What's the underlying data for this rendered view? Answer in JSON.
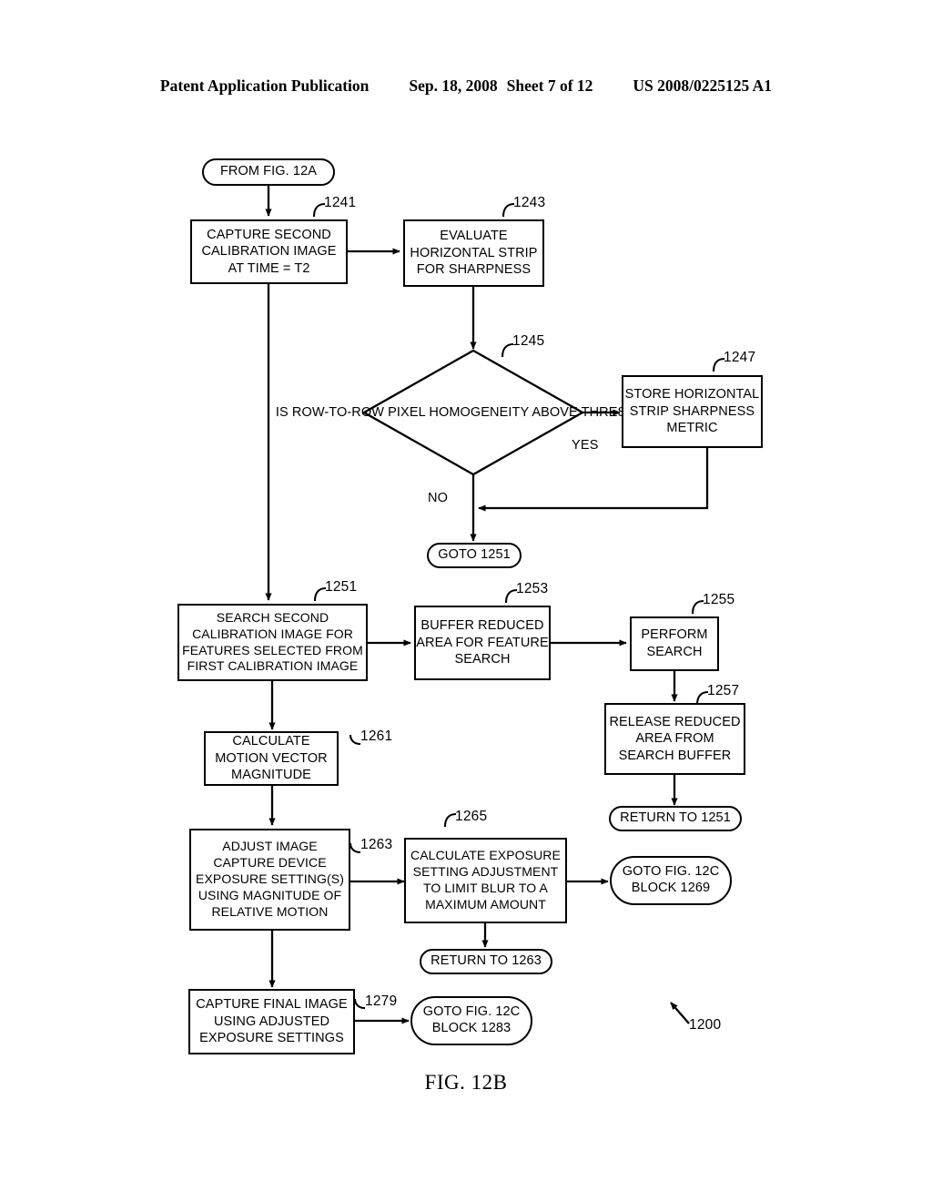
{
  "header": {
    "publication": "Patent Application Publication",
    "date": "Sep. 18, 2008",
    "sheet": "Sheet 7 of 12",
    "docnum": "US 2008/0225125 A1"
  },
  "figure": {
    "caption": "FIG. 12B",
    "diagram_ref": "1200",
    "nodes": {
      "from_fig_12a": {
        "line1": "FROM FIG. 12A"
      },
      "n1241": {
        "ref": "1241",
        "line1": "CAPTURE SECOND",
        "line2": "CALIBRATION IMAGE",
        "line3": "AT TIME = T2"
      },
      "n1243": {
        "ref": "1243",
        "line1": "EVALUATE",
        "line2": "HORIZONTAL STRIP",
        "line3": "FOR SHARPNESS"
      },
      "n1245": {
        "ref": "1245",
        "line1": "IS ROW-TO-ROW",
        "line2": "PIXEL",
        "line3": "HOMOGENEITY",
        "line4": "ABOVE THRESHOLD?",
        "yes_label": "YES",
        "no_label": "NO"
      },
      "n1247": {
        "ref": "1247",
        "line1": "STORE HORIZONTAL",
        "line2": "STRIP SHARPNESS",
        "line3": "METRIC"
      },
      "goto_1251": {
        "line1": "GOTO 1251"
      },
      "n1251": {
        "ref": "1251",
        "line1": "SEARCH SECOND",
        "line2": "CALIBRATION IMAGE FOR",
        "line3": "FEATURES SELECTED FROM",
        "line4": "FIRST CALIBRATION IMAGE"
      },
      "n1253": {
        "ref": "1253",
        "line1": "BUFFER REDUCED",
        "line2": "AREA FOR FEATURE",
        "line3": "SEARCH"
      },
      "n1255": {
        "ref": "1255",
        "line1": "PERFORM",
        "line2": "SEARCH"
      },
      "n1257": {
        "ref": "1257",
        "line1": "RELEASE REDUCED",
        "line2": "AREA FROM",
        "line3": "SEARCH BUFFER"
      },
      "return_to_1251": {
        "line1": "RETURN TO 1251"
      },
      "n1261": {
        "ref": "1261",
        "line1": "CALCULATE",
        "line2": "MOTION VECTOR",
        "line3": "MAGNITUDE"
      },
      "n1263": {
        "ref": "1263",
        "line1": "ADJUST IMAGE",
        "line2": "CAPTURE DEVICE",
        "line3": "EXPOSURE SETTING(S)",
        "line4": "USING MAGNITUDE OF",
        "line5": "RELATIVE MOTION"
      },
      "n1265": {
        "ref": "1265",
        "line1": "CALCULATE EXPOSURE",
        "line2": "SETTING ADJUSTMENT",
        "line3": "TO LIMIT BLUR TO A",
        "line4": "MAXIMUM AMOUNT"
      },
      "goto_12c_1269": {
        "line1": "GOTO FIG. 12C",
        "line2": "BLOCK 1269"
      },
      "return_to_1263": {
        "line1": "RETURN TO 1263"
      },
      "n1279": {
        "ref": "1279",
        "line1": "CAPTURE FINAL IMAGE",
        "line2": "USING ADJUSTED",
        "line3": "EXPOSURE SETTINGS"
      },
      "goto_12c_1283": {
        "line1": "GOTO FIG. 12C",
        "line2": "BLOCK 1283"
      }
    }
  }
}
